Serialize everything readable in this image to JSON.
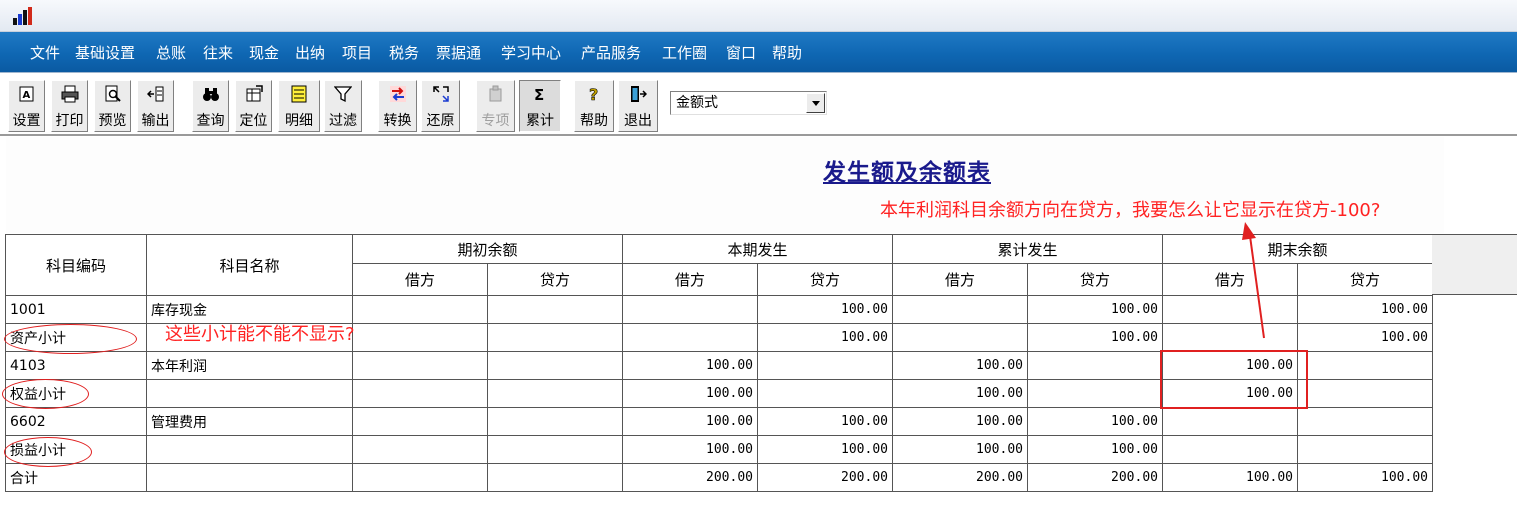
{
  "menu": [
    "文件",
    "基础设置",
    "总账",
    "往来",
    "现金",
    "出纳",
    "项目",
    "税务",
    "票据通",
    "学习中心",
    "产品服务",
    "工作圈",
    "窗口",
    "帮助"
  ],
  "toolbar": [
    {
      "label": "设置",
      "icon": "settings-icon"
    },
    {
      "label": "打印",
      "icon": "printer-icon"
    },
    {
      "label": "预览",
      "icon": "preview-icon"
    },
    {
      "label": "输出",
      "icon": "export-icon"
    },
    {
      "label": "查询",
      "icon": "binoculars-icon"
    },
    {
      "label": "定位",
      "icon": "locate-icon"
    },
    {
      "label": "明细",
      "icon": "detail-icon"
    },
    {
      "label": "过滤",
      "icon": "filter-icon"
    },
    {
      "label": "转换",
      "icon": "convert-icon"
    },
    {
      "label": "还原",
      "icon": "restore-icon"
    },
    {
      "label": "专项",
      "icon": "special-icon",
      "disabled": true
    },
    {
      "label": "累计",
      "icon": "sigma-icon",
      "pressed": true
    },
    {
      "label": "帮助",
      "icon": "help-icon"
    },
    {
      "label": "退出",
      "icon": "exit-icon"
    }
  ],
  "format_select": {
    "value": "金额式"
  },
  "report": {
    "title": "发生额及余额表"
  },
  "annotations": {
    "top": "本年利润科目余额方向在贷方，我要怎么让它显示在贷方-100?",
    "middle": "这些小计能不能不显示?"
  },
  "table": {
    "col_code": "科目编码",
    "col_name": "科目名称",
    "groups": [
      "期初余额",
      "本期发生",
      "累计发生",
      "期末余额"
    ],
    "debit": "借方",
    "credit": "贷方",
    "rows": [
      {
        "code": "1001",
        "name": "库存现金",
        "v": [
          "",
          "",
          "",
          "100.00",
          "",
          "100.00",
          "",
          "100.00"
        ]
      },
      {
        "code": "资产小计",
        "name": "",
        "v": [
          "",
          "",
          "",
          "100.00",
          "",
          "100.00",
          "",
          "100.00"
        ]
      },
      {
        "code": "4103",
        "name": "本年利润",
        "v": [
          "",
          "",
          "100.00",
          "",
          "100.00",
          "",
          "100.00",
          ""
        ]
      },
      {
        "code": "权益小计",
        "name": "",
        "v": [
          "",
          "",
          "100.00",
          "",
          "100.00",
          "",
          "100.00",
          ""
        ]
      },
      {
        "code": "6602",
        "name": "管理费用",
        "v": [
          "",
          "",
          "100.00",
          "100.00",
          "100.00",
          "100.00",
          "",
          ""
        ]
      },
      {
        "code": "损益小计",
        "name": "",
        "v": [
          "",
          "",
          "100.00",
          "100.00",
          "100.00",
          "100.00",
          "",
          ""
        ]
      },
      {
        "code": "合计",
        "name": "",
        "v": [
          "",
          "",
          "200.00",
          "200.00",
          "200.00",
          "200.00",
          "100.00",
          "100.00"
        ]
      }
    ]
  },
  "colors": {
    "menubar": "#0f67b3",
    "annotation": "#ff2222",
    "title": "#1a1a8c"
  }
}
